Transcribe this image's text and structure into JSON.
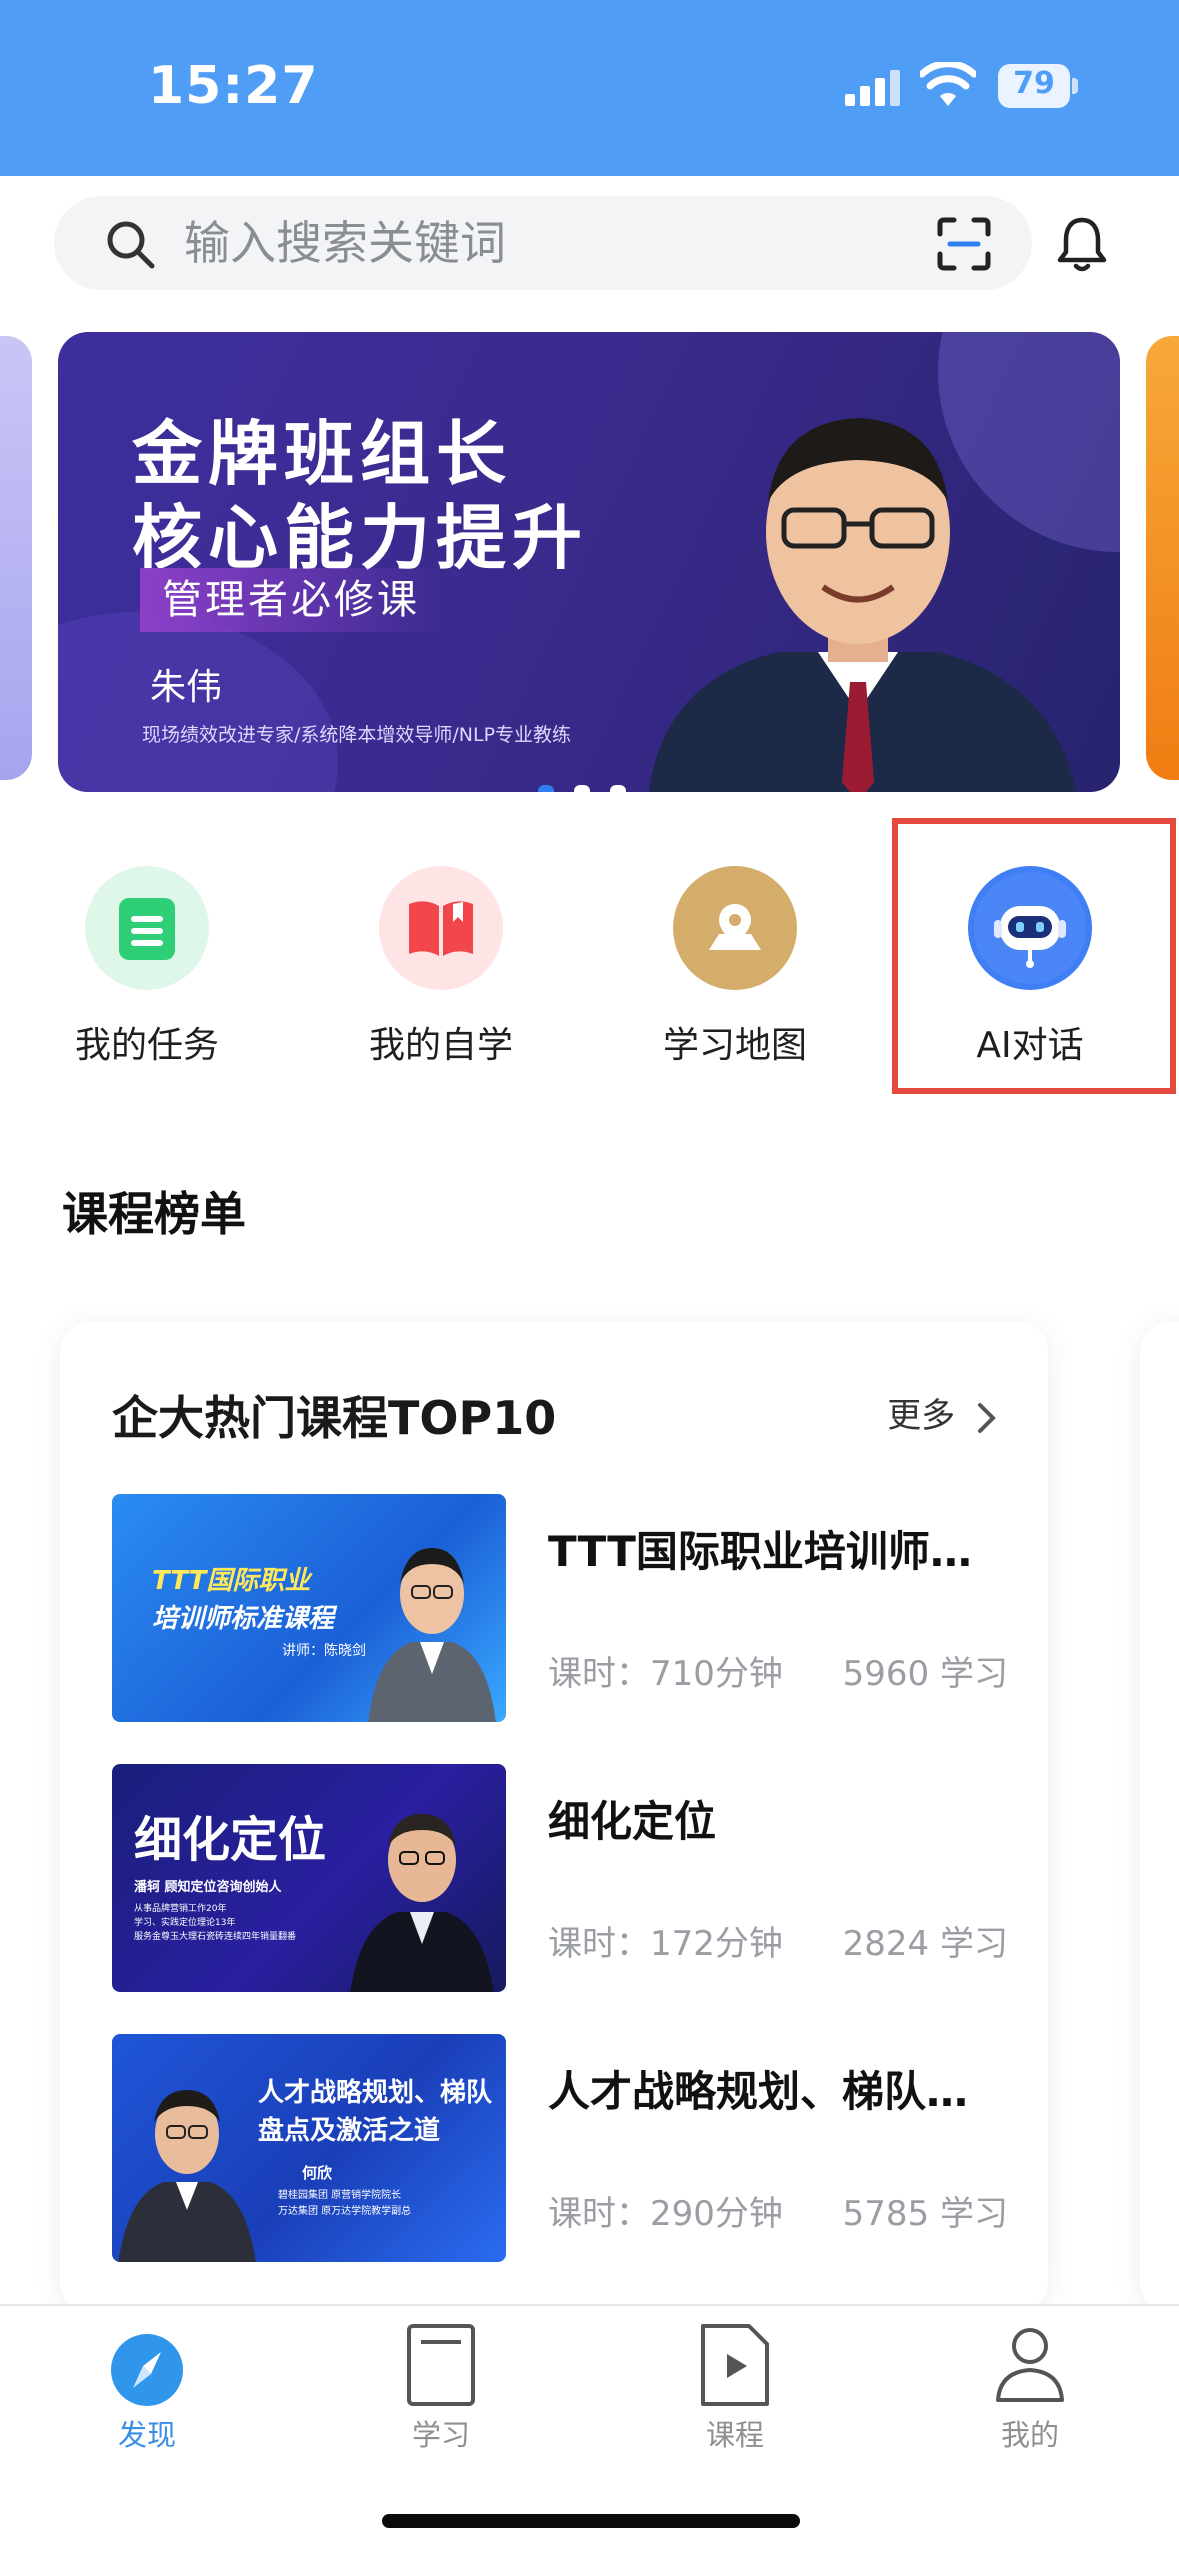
{
  "status_bar": {
    "time": "15:27",
    "battery": "79"
  },
  "search": {
    "placeholder": "输入搜索关键词"
  },
  "banner": {
    "title_line1": "金牌班组长",
    "title_line2": "核心能力提升",
    "tag": "管理者必修课",
    "speaker": "朱伟",
    "speaker_desc": "现场绩效改进专家/系统降本增效导师/NLP专业教练",
    "page_count": 3,
    "active_page": 1
  },
  "quick_entries": [
    {
      "label": "我的任务",
      "icon": "task-icon",
      "color": "#2fcf78"
    },
    {
      "label": "我的自学",
      "icon": "book-icon",
      "color": "#f0464c"
    },
    {
      "label": "学习地图",
      "icon": "map-pin-icon",
      "color": "#d4ad6a"
    },
    {
      "label": "AI对话",
      "icon": "robot-icon",
      "color": "#3f7ef5"
    }
  ],
  "section": {
    "title": "课程榜单"
  },
  "ranking_card": {
    "title": "企大热门课程TOP10",
    "more": "更多",
    "courses": [
      {
        "name": "TTT国际职业培训师标准课程",
        "time": "课时：710分钟",
        "learners": "5960 学习",
        "thumb_line1": "TTT国际职业",
        "thumb_line2": "培训师标准课程",
        "thumb_sub": "讲师：陈晓剑"
      },
      {
        "name": "细化定位",
        "time": "课时：172分钟",
        "learners": "2824 学习",
        "thumb_line1": "细化定位",
        "thumb_line2": "潘轲 顾知定位咨询创始人",
        "thumb_sub": "从事品牌营销工作20年\n学习、实践定位理论13年\n服务金尊玉大理石瓷砖连续四年销量翻番"
      },
      {
        "name": "人才战略规划、梯队盘点及激活之道",
        "time": "课时：290分钟",
        "learners": "5785 学习",
        "thumb_line1": "人才战略规划、梯队",
        "thumb_line2": "盘点及激活之道",
        "thumb_sub": "何欣",
        "thumb_sub2": "碧桂园集团 原营销学院院长\n万达集团 原万达学院教学副总"
      }
    ]
  },
  "tabbar": {
    "items": [
      {
        "label": "发现",
        "active": true
      },
      {
        "label": "学习",
        "active": false
      },
      {
        "label": "课程",
        "active": false
      },
      {
        "label": "我的",
        "active": false
      }
    ]
  }
}
